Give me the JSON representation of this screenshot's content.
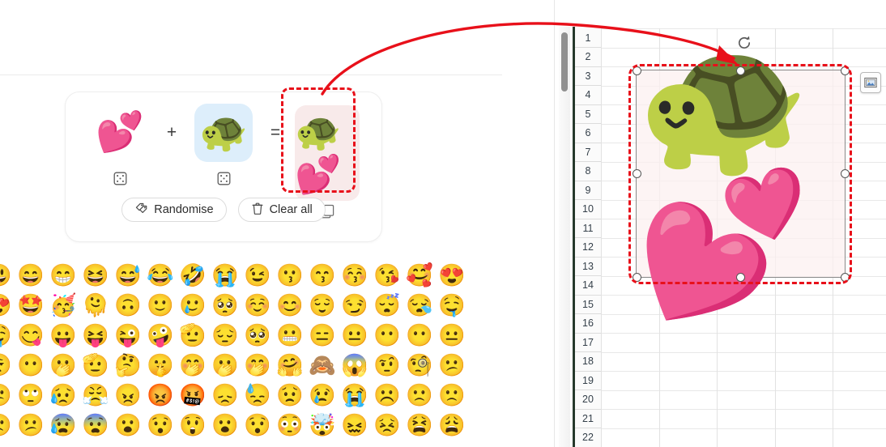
{
  "app": {
    "mixer": {
      "slot_a": {
        "emoji": "💕",
        "name": "two-hearts",
        "tile": "plain",
        "shuffle_icon": "dice-icon"
      },
      "operator_plus": "+",
      "slot_b": {
        "emoji": "🐢",
        "name": "turtle",
        "tile": "blue",
        "shuffle_icon": "dice-icon"
      },
      "operator_equals": "=",
      "result": {
        "emoji": "🐢💕",
        "name": "turtle-hearts-mashup",
        "copy_icon": "copy-icon"
      },
      "buttons": {
        "randomise": {
          "label": "Randomise",
          "icon": "shuffle-tag-icon"
        },
        "clear_all": {
          "label": "Clear all",
          "icon": "trash-icon"
        }
      }
    },
    "emoji_grid": {
      "rows": [
        [
          "😃",
          "😄",
          "😁",
          "😆",
          "😅",
          "😂",
          "🤣",
          "😭",
          "😉",
          "😗",
          "😙",
          "😚",
          "😘",
          "🥰",
          "😍"
        ],
        [
          "😍",
          "🤩",
          "🥳",
          "🫠",
          "🙃",
          "🙂",
          "🥲",
          "🥺",
          "☺️",
          "😊",
          "😌",
          "😏",
          "😴",
          "😪",
          "🤤"
        ],
        [
          "🤤",
          "😋",
          "😛",
          "😝",
          "😜",
          "🤪",
          "🫡",
          "😔",
          "🥺",
          "😬",
          "😑",
          "😐",
          "😶",
          "😶",
          "😐"
        ],
        [
          "😮‍💨",
          "😶",
          "🫢",
          "🫡",
          "🤔",
          "🤫",
          "🤭",
          "🫢",
          "🤭",
          "🤗",
          "🙈",
          "😱",
          "🤨",
          "🧐",
          "😕"
        ],
        [
          "😕",
          "🙄",
          "😥",
          "😤",
          "😠",
          "😡",
          "🤬",
          "😞",
          "😓",
          "😟",
          "😢",
          "😭",
          "☹️",
          "🙁",
          "🙁"
        ],
        [
          "🙁",
          "😕",
          "😰",
          "😨",
          "😮",
          "😯",
          "😲",
          "😮",
          "😯",
          "😳",
          "🤯",
          "😖",
          "😣",
          "😫",
          "😩"
        ]
      ]
    }
  },
  "sheet": {
    "row_numbers": [
      "1",
      "2",
      "3",
      "4",
      "5",
      "6",
      "7",
      "8",
      "9",
      "10",
      "11",
      "12",
      "13",
      "14",
      "15",
      "16",
      "17",
      "18",
      "19",
      "20",
      "21",
      "22"
    ],
    "picture": {
      "name": "inserted-emoji-picture",
      "emoji": "🐢💕",
      "rotate_icon": "rotate-icon",
      "image_options_icon": "picture-options-icon"
    }
  },
  "annotation": {
    "arrow": {
      "name": "red-curved-arrow",
      "color": "#e8101a"
    },
    "highlight_color": "#e8101a"
  }
}
